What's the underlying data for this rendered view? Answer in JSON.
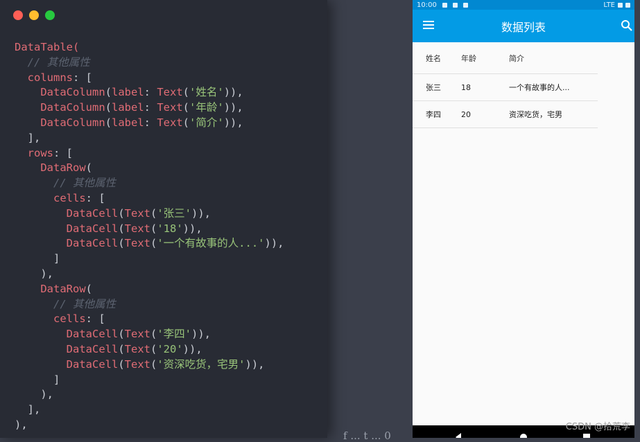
{
  "editor": {
    "traffic_lights": {
      "close": "#ff5f56",
      "minimize": "#ffbd2e",
      "maximize": "#27c93f"
    },
    "code": {
      "l1": "DataTable(",
      "comment": "// 其他属性",
      "columns_kw": "columns",
      "rows_kw": "rows",
      "cells_kw": "cells",
      "datacolumn": "DataColumn",
      "label_kw": "label",
      "text_fn": "Text",
      "datarow": "DataRow",
      "datacell": "DataCell",
      "col_names": [
        "'姓名'",
        "'年龄'",
        "'简介'"
      ],
      "row1": [
        "'张三'",
        "'18'",
        "'一个有故事的人...'"
      ],
      "row2": [
        "'李四'",
        "'20'",
        "'资深吃货，宅男'"
      ]
    }
  },
  "gap_text": "f ... t ... 0",
  "phone": {
    "status_time": "10:00",
    "status_network": "LTE",
    "app_title": "数据列表",
    "menu_icon": "hamburger-menu-icon",
    "search_icon": "search-icon",
    "table": {
      "headers": [
        "姓名",
        "年龄",
        "简介"
      ],
      "rows": [
        [
          "张三",
          "18",
          "一个有故事的人..."
        ],
        [
          "李四",
          "20",
          "资深吃货，宅男"
        ]
      ]
    },
    "colors": {
      "appbar": "#039be5",
      "statusbar": "#0288d1"
    }
  },
  "watermark": "CSDN @拾荒李"
}
